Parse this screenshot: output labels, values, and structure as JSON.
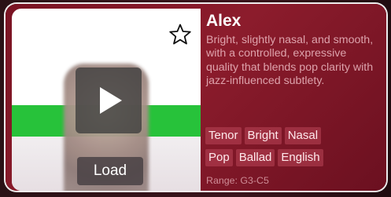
{
  "voice_card": {
    "name": "Alex",
    "description": "Bright, slightly nasal, and smooth, with a controlled, expressive quality that blends pop clarity with jazz-influenced subtlety.",
    "load_label": "Load",
    "tags_row1": [
      "Tenor",
      "Bright",
      "Nasal"
    ],
    "tags_row2": [
      "Pop",
      "Ballad",
      "English"
    ],
    "range_text": "Range: G3-C5",
    "icons": {
      "play": "play-icon",
      "favorite": "star-outline-icon"
    },
    "colors": {
      "card_background": "#8c1c2c",
      "card_border": "#ffffff",
      "tag_background": "#b94658",
      "media_green": "#27c23a"
    }
  }
}
